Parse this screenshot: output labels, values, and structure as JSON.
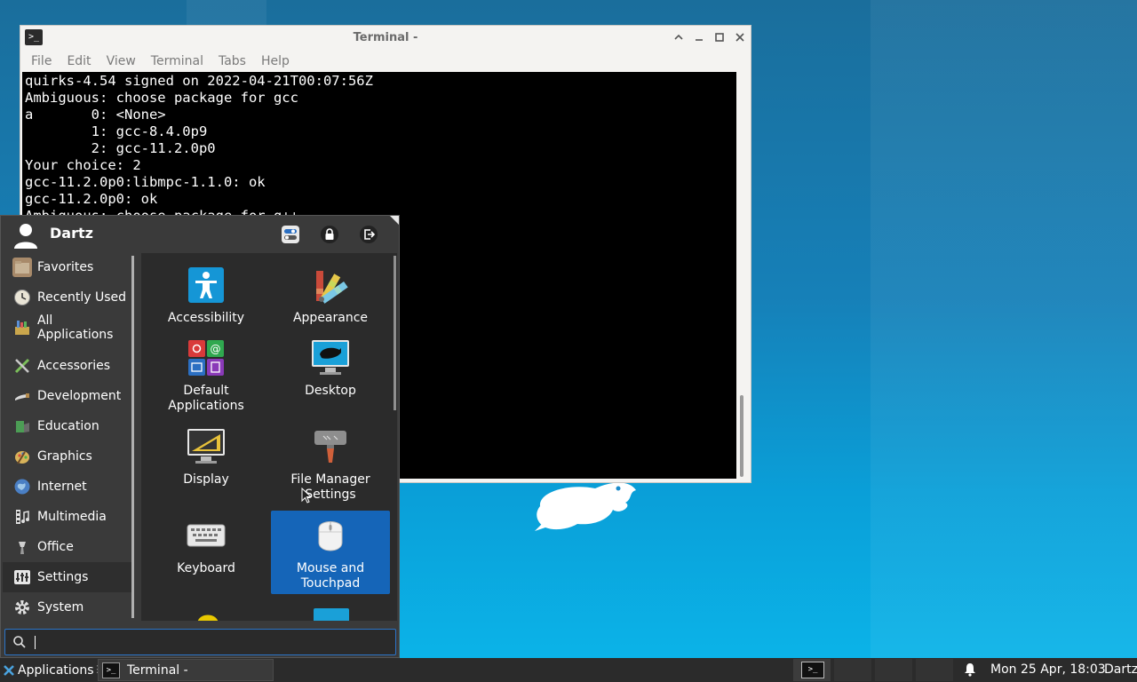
{
  "terminal": {
    "title": "Terminal -",
    "menu": [
      "File",
      "Edit",
      "View",
      "Terminal",
      "Tabs",
      "Help"
    ],
    "lines": [
      "quirks-4.54 signed on 2022-04-21T00:07:56Z",
      "Ambiguous: choose package for gcc",
      "a       0: <None>",
      "        1: gcc-8.4.0p9",
      "        2: gcc-11.2.0p0",
      "Your choice: 2",
      "gcc-11.2.0p0:libmpc-1.1.0: ok",
      "gcc-11.2.0p0: ok",
      "Ambiguous: choose package for g++"
    ]
  },
  "menu": {
    "user_name": "Dartz",
    "actions": [
      "settings-manager-icon",
      "lock-icon",
      "logout-icon"
    ],
    "categories": [
      {
        "label": "Favorites",
        "icon": "favorites-icon"
      },
      {
        "label": "Recently Used",
        "icon": "recent-icon"
      },
      {
        "label": "All Applications",
        "icon": "all-apps-icon"
      },
      {
        "label": "Accessories",
        "icon": "accessories-icon"
      },
      {
        "label": "Development",
        "icon": "development-icon"
      },
      {
        "label": "Education",
        "icon": "education-icon"
      },
      {
        "label": "Graphics",
        "icon": "graphics-icon"
      },
      {
        "label": "Internet",
        "icon": "internet-icon"
      },
      {
        "label": "Multimedia",
        "icon": "multimedia-icon"
      },
      {
        "label": "Office",
        "icon": "office-icon"
      },
      {
        "label": "Settings",
        "icon": "settings-icon"
      },
      {
        "label": "System",
        "icon": "system-icon"
      }
    ],
    "selected_category": "Settings",
    "apps": [
      {
        "label": "Accessibility",
        "icon": "accessibility-icon"
      },
      {
        "label": "Appearance",
        "icon": "appearance-icon"
      },
      {
        "label": "Default Applications",
        "icon": "default-applications-icon"
      },
      {
        "label": "Desktop",
        "icon": "desktop-icon"
      },
      {
        "label": "Display",
        "icon": "display-icon"
      },
      {
        "label": "File Manager Settings",
        "icon": "file-manager-settings-icon"
      },
      {
        "label": "Keyboard",
        "icon": "keyboard-icon"
      },
      {
        "label": "Mouse and Touchpad",
        "icon": "mouse-icon"
      }
    ],
    "selected_app": "Mouse and Touchpad",
    "search": {
      "value": "",
      "placeholder": ""
    }
  },
  "taskbar": {
    "applications_label": "Applications",
    "task_label": "Terminal -",
    "clock": "Mon 25 Apr, 18:03",
    "user": "Dartz"
  },
  "colors": {
    "accent": "#1565b8",
    "panel": "#2b2b2b",
    "menu_bg": "#3a3a3a"
  }
}
